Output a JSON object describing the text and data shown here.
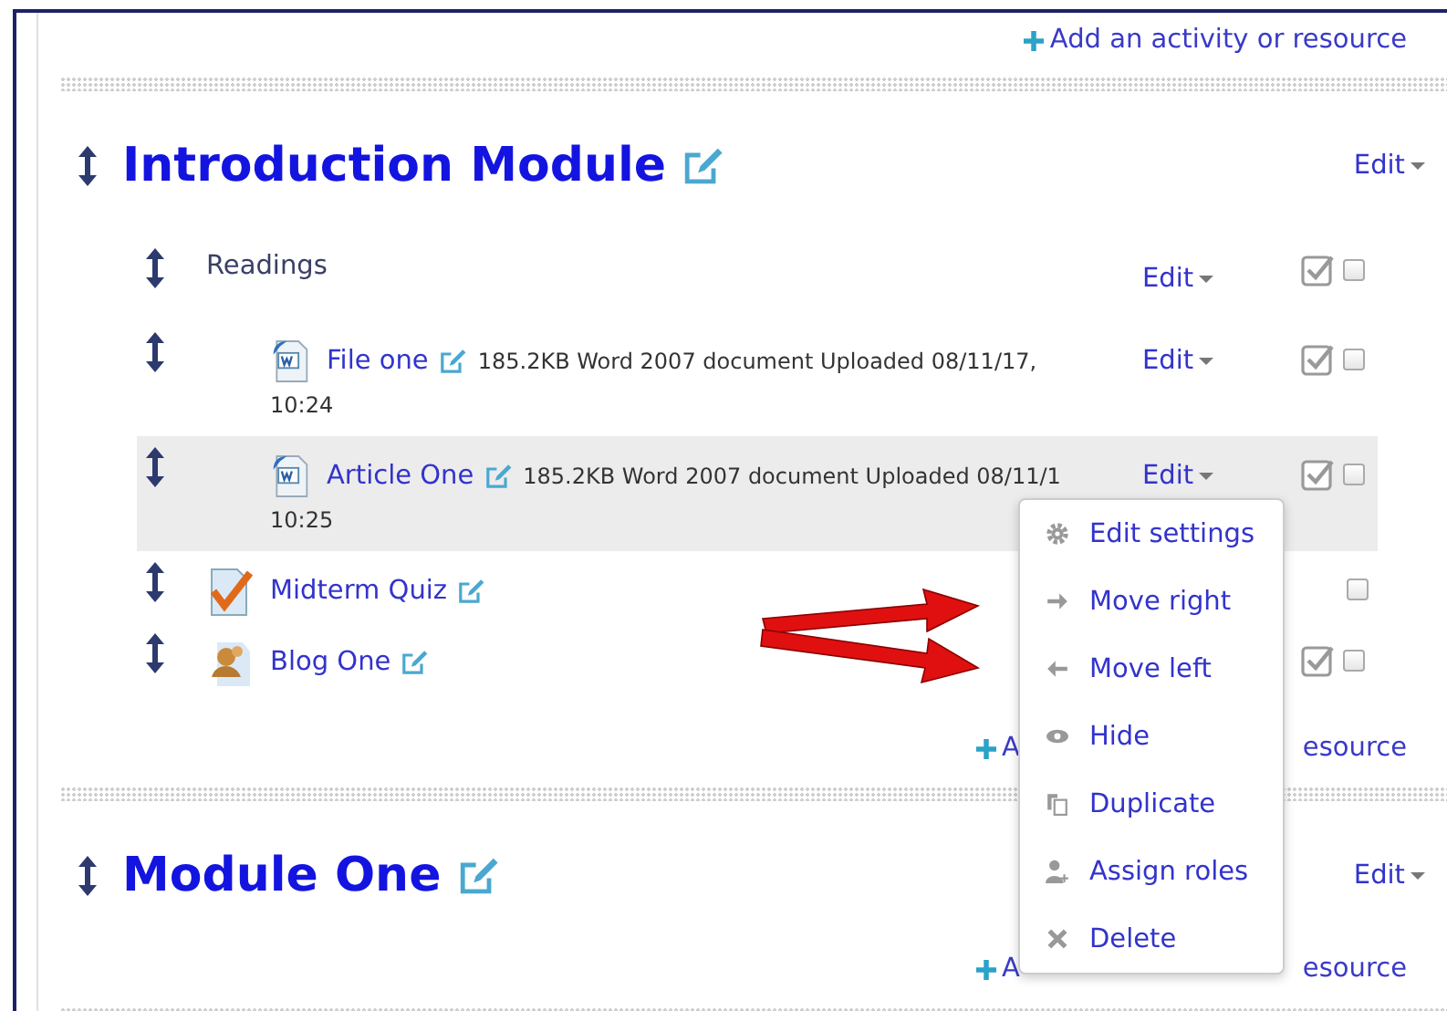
{
  "top_add_link": {
    "label": "Add an activity or resource"
  },
  "sections": [
    {
      "title": "Introduction Module",
      "edit": "Edit",
      "activities": [
        {
          "kind": "label",
          "name": "Readings",
          "edit": "Edit",
          "completion_icon": true,
          "checked": false,
          "highlighted": false,
          "children": [
            {
              "kind": "file",
              "name": "File one",
              "meta": "185.2KB Word 2007 document Uploaded 08/11/17,",
              "time": "10:24",
              "edit": "Edit",
              "completion_icon": true,
              "checked": false,
              "highlighted": false
            },
            {
              "kind": "file",
              "name": "Article One",
              "meta": "185.2KB Word 2007 document Uploaded 08/11/1",
              "time": "10:25",
              "edit": "Edit",
              "completion_icon": true,
              "checked": false,
              "highlighted": true
            }
          ]
        },
        {
          "kind": "quiz",
          "name": "Midterm Quiz",
          "completion_icon": false,
          "checked": false,
          "highlighted": false
        },
        {
          "kind": "blog",
          "name": "Blog One",
          "completion_icon": true,
          "checked": false,
          "highlighted": false
        }
      ],
      "add_link": {
        "start": "A",
        "end": "esource"
      }
    },
    {
      "title": "Module One",
      "edit": "Edit",
      "add_link": {
        "start": "A",
        "end": "esource"
      }
    }
  ],
  "menu": {
    "items": [
      {
        "kind": "settings",
        "label": "Edit settings"
      },
      {
        "kind": "right",
        "label": "Move right"
      },
      {
        "kind": "left",
        "label": "Move left"
      },
      {
        "kind": "hide",
        "label": "Hide"
      },
      {
        "kind": "duplicate",
        "label": "Duplicate"
      },
      {
        "kind": "roles",
        "label": "Assign roles"
      },
      {
        "kind": "delete",
        "label": "Delete"
      }
    ]
  }
}
